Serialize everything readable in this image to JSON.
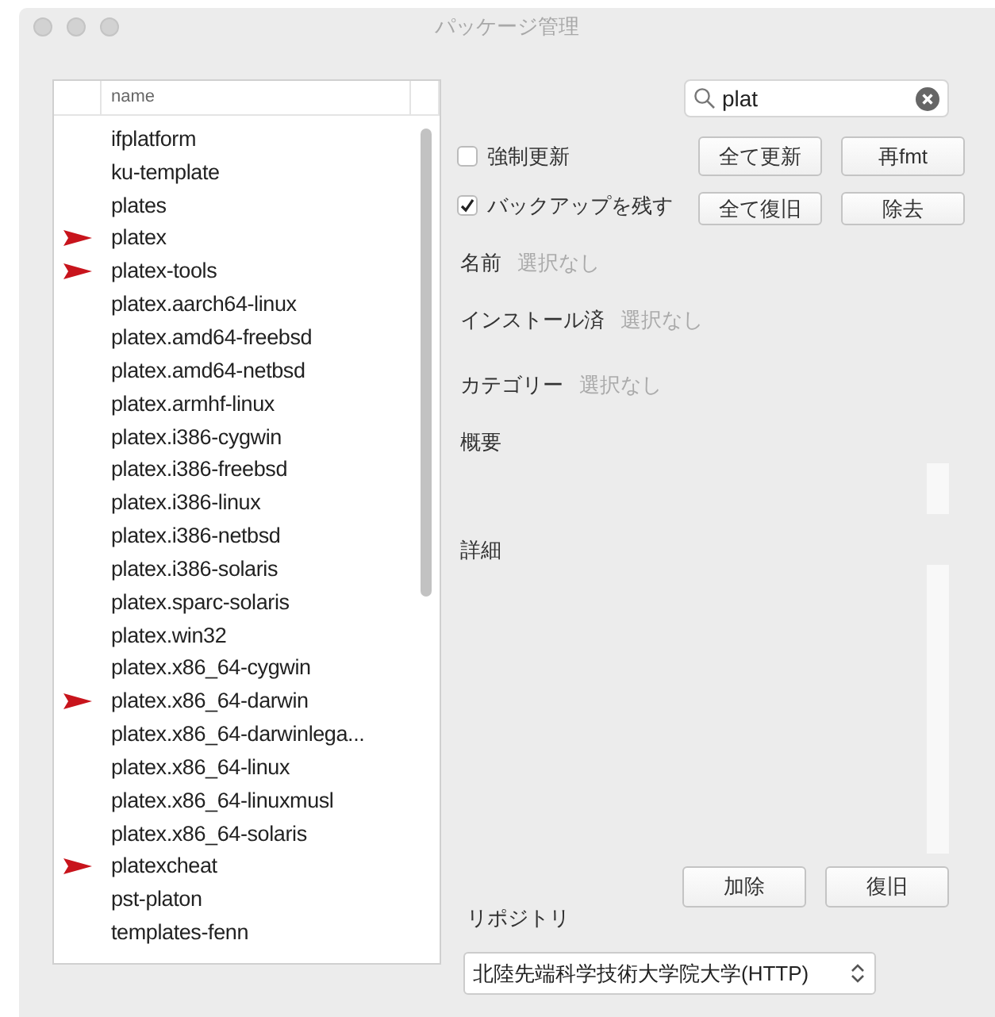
{
  "window": {
    "title": "パッケージ管理"
  },
  "package_list": {
    "column": "name",
    "items": [
      {
        "name": "ifplatform",
        "flagged": false
      },
      {
        "name": "ku-template",
        "flagged": false
      },
      {
        "name": "plates",
        "flagged": false
      },
      {
        "name": "platex",
        "flagged": true
      },
      {
        "name": "platex-tools",
        "flagged": true
      },
      {
        "name": "platex.aarch64-linux",
        "flagged": false
      },
      {
        "name": "platex.amd64-freebsd",
        "flagged": false
      },
      {
        "name": "platex.amd64-netbsd",
        "flagged": false
      },
      {
        "name": "platex.armhf-linux",
        "flagged": false
      },
      {
        "name": "platex.i386-cygwin",
        "flagged": false
      },
      {
        "name": "platex.i386-freebsd",
        "flagged": false
      },
      {
        "name": "platex.i386-linux",
        "flagged": false
      },
      {
        "name": "platex.i386-netbsd",
        "flagged": false
      },
      {
        "name": "platex.i386-solaris",
        "flagged": false
      },
      {
        "name": "platex.sparc-solaris",
        "flagged": false
      },
      {
        "name": "platex.win32",
        "flagged": false
      },
      {
        "name": "platex.x86_64-cygwin",
        "flagged": false
      },
      {
        "name": "platex.x86_64-darwin",
        "flagged": true
      },
      {
        "name": "platex.x86_64-darwinlega...",
        "flagged": false
      },
      {
        "name": "platex.x86_64-linux",
        "flagged": false
      },
      {
        "name": "platex.x86_64-linuxmusl",
        "flagged": false
      },
      {
        "name": "platex.x86_64-solaris",
        "flagged": false
      },
      {
        "name": "platexcheat",
        "flagged": true
      },
      {
        "name": "pst-platon",
        "flagged": false
      },
      {
        "name": "templates-fenn",
        "flagged": false
      }
    ]
  },
  "search": {
    "value": "plat"
  },
  "options": [
    {
      "label": "強制更新",
      "checked": false
    },
    {
      "label": "バックアップを残す",
      "checked": true
    }
  ],
  "buttons": [
    "全て更新",
    "再fmt",
    "全て復旧",
    "除去"
  ],
  "details": [
    {
      "label": "名前",
      "value": "選択なし"
    },
    {
      "label": "インストール済",
      "value": "選択なし"
    },
    {
      "label": "カテゴリー",
      "value": "選択なし"
    }
  ],
  "summary": {
    "label": "概要"
  },
  "detail": {
    "label": "詳細"
  },
  "detail_buttons": [
    "加除",
    "復旧"
  ],
  "repository": {
    "label": "リポジトリ",
    "selected": "北陸先端科学技術大学院大学(HTTP)"
  }
}
